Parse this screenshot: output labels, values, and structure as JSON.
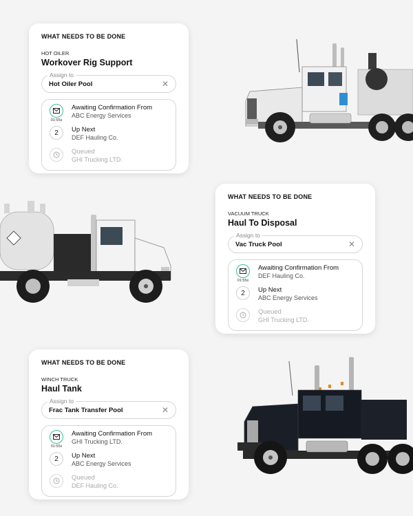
{
  "cards": [
    {
      "heading": "WHAT NEEDS TO BE DONE",
      "job_type": "HOT OILER",
      "job_title": "Workover Rig Support",
      "assign_label": "Assign to",
      "assign_value": "Hot Oiler Pool",
      "queue": [
        {
          "label": "Awaiting Confirmation From",
          "company": "ABC Energy Services",
          "icon": "mail-icon",
          "timer": "01:55s"
        },
        {
          "label": "Up Next",
          "company": "DEF Hauling Co.",
          "icon": "number-icon",
          "number": "2"
        },
        {
          "label": "Queued",
          "company": "GHI Trucking LTD.",
          "icon": "clock-icon"
        }
      ]
    },
    {
      "heading": "WHAT NEEDS TO BE DONE",
      "job_type": "VACUUM TRUCK",
      "job_title": "Haul To Disposal",
      "assign_label": "Assign to",
      "assign_value": "Vac Truck Pool",
      "queue": [
        {
          "label": "Awaiting Confirmation From",
          "company": "DEF Hauling Co.",
          "icon": "mail-icon",
          "timer": "01:55s"
        },
        {
          "label": "Up Next",
          "company": "ABC Energy Services",
          "icon": "number-icon",
          "number": "2"
        },
        {
          "label": "Queued",
          "company": "GHI Trucking LTD.",
          "icon": "clock-icon"
        }
      ]
    },
    {
      "heading": "WHAT NEEDS TO BE DONE",
      "job_type": "WINCH TRUCK",
      "job_title": "Haul Tank",
      "assign_label": "Assign to",
      "assign_value": "Frac Tank Transfer Pool",
      "queue": [
        {
          "label": "Awaiting Confirmation From",
          "company": "GHI Trucking LTD.",
          "icon": "mail-icon",
          "timer": "01:55s"
        },
        {
          "label": "Up Next",
          "company": "ABC Energy Services",
          "icon": "number-icon",
          "number": "2"
        },
        {
          "label": "Queued",
          "company": "DEF Hauling Co.",
          "icon": "clock-icon"
        }
      ]
    }
  ],
  "colors": {
    "accent_green": "#3cbf8e",
    "background": "#f4f4f4",
    "card": "#ffffff"
  }
}
